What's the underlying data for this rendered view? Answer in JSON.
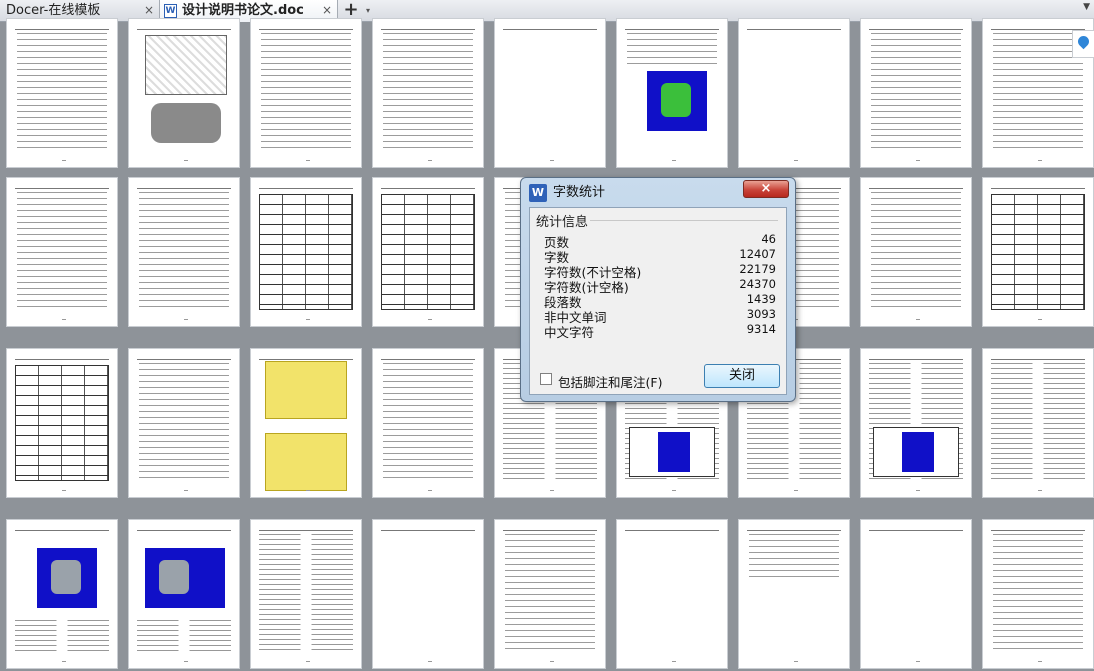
{
  "tabs": [
    {
      "label": "Docer-在线模板",
      "active": false
    },
    {
      "label": "设计说明书论文.doc",
      "active": true
    }
  ],
  "tab_close_glyph": "×",
  "new_tab_glyph": "+",
  "new_tab_dropdown_glyph": "▾",
  "tab_list_glyph": "▼",
  "doc_icon_letter": "W",
  "dialog": {
    "title": "字数统计",
    "logo_letter": "W",
    "close_glyph": "×",
    "section_title": "统计信息",
    "stats": [
      {
        "label": "页数",
        "value": "46"
      },
      {
        "label": "字数",
        "value": "12407"
      },
      {
        "label": "字符数(不计空格)",
        "value": "22179"
      },
      {
        "label": "字符数(计空格)",
        "value": "24370"
      },
      {
        "label": "段落数",
        "value": "1439"
      },
      {
        "label": "非中文单词",
        "value": "3093"
      },
      {
        "label": "中文字符",
        "value": "9314"
      }
    ],
    "checkbox_label": "包括脚注和尾注(F)",
    "checkbox_checked": false,
    "close_button": "关闭"
  },
  "icons": {
    "doc": "word-document-icon",
    "pin": "location-pin-icon"
  },
  "colors": {
    "dialog_accent": "#2f62b8",
    "close_red": "#c9453a",
    "page_background": "#8e9399"
  }
}
